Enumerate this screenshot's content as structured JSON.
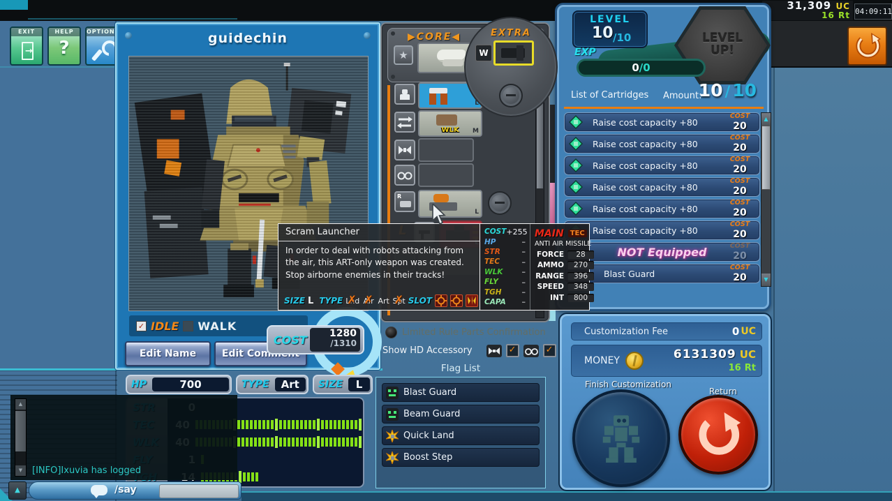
{
  "colors": {
    "accent_orange": "#f08010",
    "teal": "#35d0e8",
    "bar_green": "#86e81c",
    "alert_red": "#e82818",
    "gold": "#e8c820",
    "pink_glow": "#f8d0ec"
  },
  "icons": {
    "star": "★",
    "check": "✓",
    "cross": "✗",
    "up_arrow": "▲",
    "down_arrow": "▼",
    "question": "?",
    "minus": "–",
    "dots": "●●●"
  },
  "top_bar": {
    "uc_amount": "31,309",
    "uc_unit": "UC",
    "rt_amount": "16",
    "rt_unit": "Rt",
    "time": "04:09:11"
  },
  "toolbar": {
    "exit": "EXIT",
    "help": "HELP",
    "options": "OPTIONS"
  },
  "robot_panel": {
    "name": "guidechin",
    "idle_label": "IDLE",
    "walk_label": "WALK",
    "edit_name": "Edit Name",
    "edit_comment": "Edit Comment",
    "cost_label": "COST",
    "cost_value": "1280",
    "cost_max": "/1310"
  },
  "stats_panel": {
    "hp_label": "HP",
    "hp_value": "700",
    "type_label": "TYPE",
    "type_value": "Art",
    "size_label": "SIZE",
    "size_value": "L",
    "rows": [
      {
        "label": "STR",
        "value": 0
      },
      {
        "label": "TEC",
        "value": 40
      },
      {
        "label": "WLK",
        "value": 40
      },
      {
        "label": "FLY",
        "value": 1
      },
      {
        "label": "TGH",
        "value": 14
      }
    ]
  },
  "parts_panel": {
    "core_label": "▶CORE◀",
    "extra_label": "EXTRA",
    "w_slot": "W",
    "wlk_tag": "WLK",
    "l_slot": "L",
    "sizes": {
      "core": "L",
      "body": "L",
      "legs": "M",
      "arm": "L",
      "weapon": "L"
    }
  },
  "tooltip": {
    "title": "Scram Launcher",
    "desc_line1": "In order to deal with robots attacking from",
    "desc_line2": "the air, this ART-only weapon was created.",
    "desc_line3": "Stop airborne enemies in their tracks!",
    "size_label": "SIZE",
    "size_value": "L",
    "type_label": "TYPE",
    "slot_label": "SLOT",
    "types": [
      {
        "label": "Lnd",
        "crossed": true
      },
      {
        "label": "Air",
        "crossed": true
      },
      {
        "label": "Art",
        "crossed": false
      },
      {
        "label": "Spt",
        "crossed": true
      }
    ]
  },
  "stat_diff": {
    "rows": [
      {
        "label": "COST",
        "value": "+255",
        "color": "#2ad8d8"
      },
      {
        "label": "HP",
        "value": "–",
        "color": "#5aa8e8"
      },
      {
        "label": "STR",
        "value": "–",
        "color": "#e05818"
      },
      {
        "label": "TEC",
        "value": "–",
        "color": "#e07818"
      },
      {
        "label": "WLK",
        "value": "–",
        "color": "#48c838"
      },
      {
        "label": "FLY",
        "value": "–",
        "color": "#68d838"
      },
      {
        "label": "TGH",
        "value": "–",
        "color": "#c8b018"
      },
      {
        "label": "CAPA",
        "value": "–",
        "color": "#9ae8b8"
      }
    ]
  },
  "weapon_stats": {
    "main_label": "MAIN",
    "tec_label": "TEC",
    "weapon_name": "ANTI AIR MISSILE",
    "rows": [
      {
        "label": "FORCE",
        "value": "28"
      },
      {
        "label": "AMMO",
        "value": "270"
      },
      {
        "label": "RANGE",
        "value": "396"
      },
      {
        "label": "SPEED",
        "value": "348"
      },
      {
        "label": "INT",
        "value": "800"
      }
    ]
  },
  "level_panel": {
    "level_label": "LEVEL",
    "level_value": "10",
    "level_max": "/10",
    "exp_label": "EXP",
    "exp_current": "0",
    "exp_sep": "/",
    "exp_max": "0",
    "level_up": "LEVEL UP!",
    "cartridges_title": "List of Cartridges",
    "amount_label": "Amount:",
    "amount_current": "10",
    "amount_sep": "/",
    "amount_max": "10"
  },
  "cartridges": {
    "rows": [
      {
        "name": "Raise cost capacity +80",
        "cost_label": "COST",
        "cost": "20"
      },
      {
        "name": "Raise cost capacity +80",
        "cost_label": "COST",
        "cost": "20"
      },
      {
        "name": "Raise cost capacity +80",
        "cost_label": "COST",
        "cost": "20"
      },
      {
        "name": "Raise cost capacity +80",
        "cost_label": "COST",
        "cost": "20"
      },
      {
        "name": "Raise cost capacity +80",
        "cost_label": "COST",
        "cost": "20"
      },
      {
        "name": "Raise cost capacity +80",
        "cost_label": "COST",
        "cost": "20"
      },
      {
        "name": "",
        "cost_label": "COST",
        "cost": "20",
        "overlay": "NOT Equipped"
      },
      {
        "name": "Blast Guard",
        "cost_label": "COST",
        "cost": "20"
      }
    ]
  },
  "options_row": {
    "limited_rule": "Limited Rule Parts Confirmation",
    "show_hd": "Show HD Accessory"
  },
  "flag_list": {
    "title": "Flag List",
    "items": [
      {
        "label": "Blast Guard"
      },
      {
        "label": "Beam Guard"
      },
      {
        "label": "Quick Land"
      },
      {
        "label": "Boost Step"
      }
    ]
  },
  "checkout": {
    "fee_label": "Customization Fee",
    "fee_value": "0",
    "fee_unit": "UC",
    "money_label": "MONEY",
    "money_value": "6131309",
    "money_unit": "UC",
    "money_rt": "16",
    "money_rt_unit": "Rt",
    "finish_label": "Finish Customization",
    "return_label": "Return"
  },
  "chat": {
    "info_line": "[INFO]Ixuvia has logged",
    "say_label": "/say"
  }
}
